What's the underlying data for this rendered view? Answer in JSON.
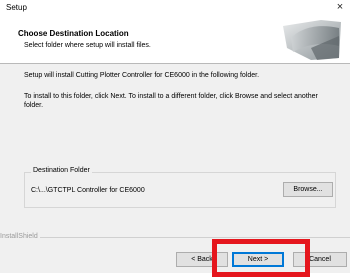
{
  "window": {
    "title": "Setup",
    "close_glyph": "×"
  },
  "header": {
    "title": "Choose Destination Location",
    "subtitle": "Select folder where setup will install files."
  },
  "body": {
    "line1": "Setup will install Cutting Plotter Controller for CE6000 in the following folder.",
    "line2": "To install to this folder, click Next. To install to a different folder, click Browse and select another folder."
  },
  "destination": {
    "label": "Destination Folder",
    "path": "C:\\...\\GTCTPL Controller for CE6000",
    "browse_label": "Browse..."
  },
  "footer": {
    "brand": "InstallShield",
    "back_label": "< Back",
    "next_label": "Next >",
    "cancel_label": "Cancel"
  },
  "colors": {
    "highlight": "#e5161d",
    "focus_border": "#0078d7"
  }
}
